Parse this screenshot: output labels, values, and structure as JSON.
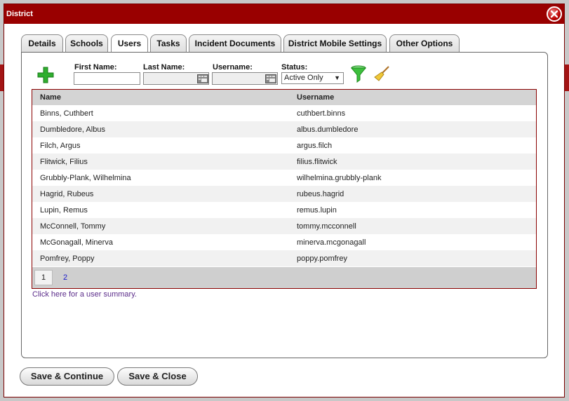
{
  "dialog": {
    "title": "District"
  },
  "tabs": [
    {
      "label": "Details"
    },
    {
      "label": "Schools"
    },
    {
      "label": "Users"
    },
    {
      "label": "Tasks"
    },
    {
      "label": "Incident Documents"
    },
    {
      "label": "District Mobile Settings"
    },
    {
      "label": "Other Options"
    }
  ],
  "active_tab": "Users",
  "filters": {
    "first_name_label": "First Name:",
    "first_name_value": "",
    "last_name_label": "Last Name:",
    "last_name_value": "",
    "username_label": "Username:",
    "username_value": "",
    "status_label": "Status:",
    "status_value": "Active Only"
  },
  "icons": {
    "add": "add-icon",
    "last_name_picker": "lookup-icon",
    "username_picker": "lookup-icon",
    "filter": "filter-funnel-icon",
    "clear": "broom-icon",
    "close": "close-icon"
  },
  "grid": {
    "columns": [
      "Name",
      "Username"
    ],
    "rows": [
      [
        "Binns, Cuthbert",
        "cuthbert.binns"
      ],
      [
        "Dumbledore, Albus",
        "albus.dumbledore"
      ],
      [
        "Filch, Argus",
        "argus.filch"
      ],
      [
        "Flitwick, Filius",
        "filius.flitwick"
      ],
      [
        "Grubbly-Plank, Wilhelmina",
        "wilhelmina.grubbly-plank"
      ],
      [
        "Hagrid, Rubeus",
        "rubeus.hagrid"
      ],
      [
        "Lupin, Remus",
        "remus.lupin"
      ],
      [
        "McConnell, Tommy",
        "tommy.mcconnell"
      ],
      [
        "McGonagall, Minerva",
        "minerva.mcgonagall"
      ],
      [
        "Pomfrey, Poppy",
        "poppy.pomfrey"
      ]
    ],
    "pages": [
      "1",
      "2"
    ],
    "current_page": "1"
  },
  "summary_link": "Click here for a user summary.",
  "buttons": {
    "save_continue": "Save & Continue",
    "save_close": "Save & Close"
  },
  "colors": {
    "titlebar": "#990000",
    "grid_border": "#8a0000",
    "link": "#1a1acc",
    "summary_link": "#5b2c8a"
  }
}
